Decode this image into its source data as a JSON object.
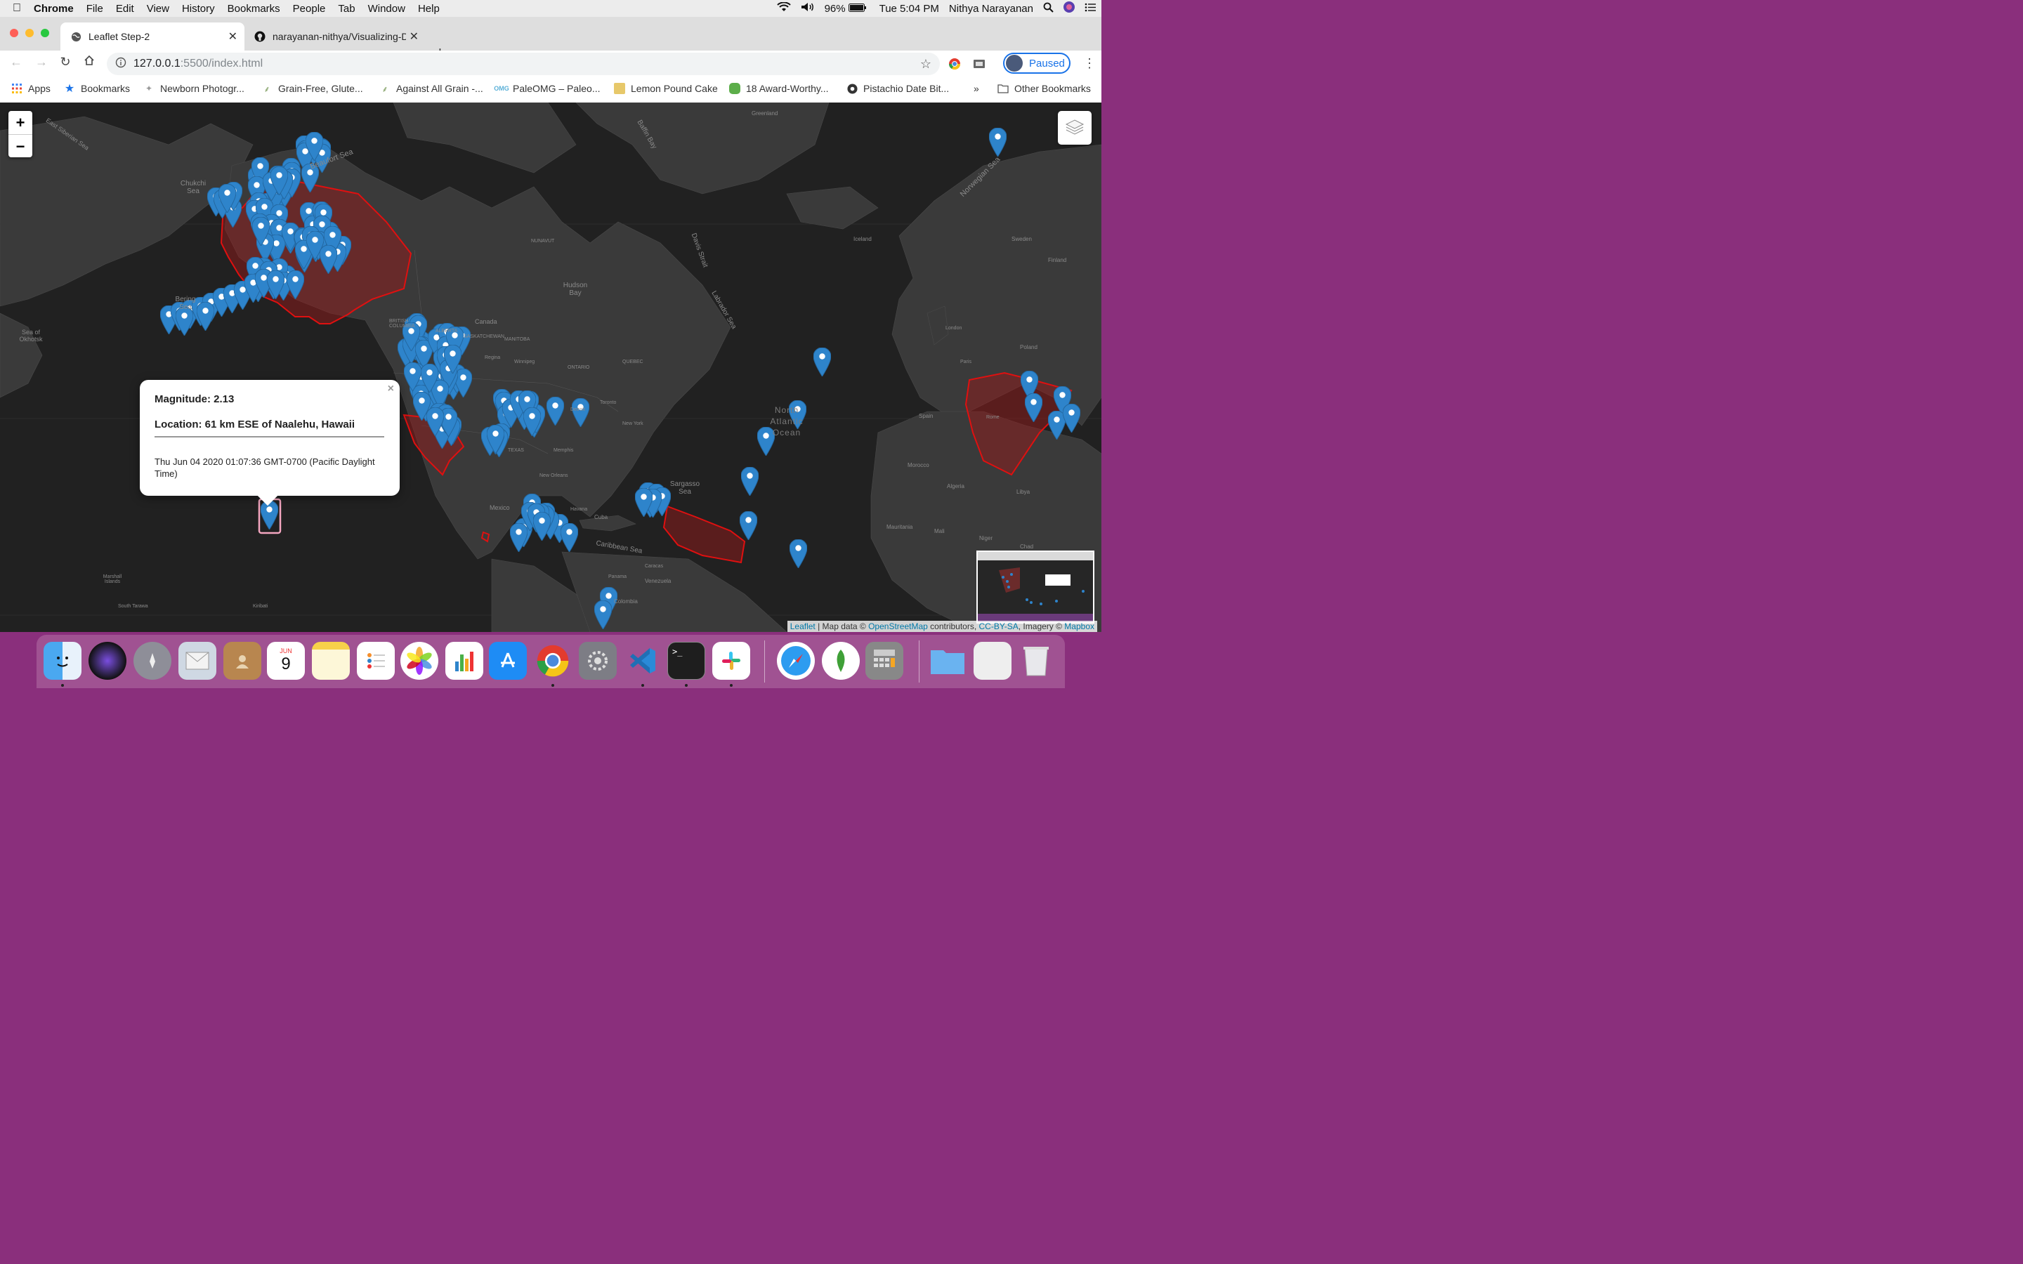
{
  "menubar": {
    "app": "Chrome",
    "items": [
      "File",
      "Edit",
      "View",
      "History",
      "Bookmarks",
      "People",
      "Tab",
      "Window",
      "Help"
    ],
    "battery": "96%",
    "clock": "Tue 5:04 PM",
    "user": "Nithya Narayanan"
  },
  "tabs": [
    {
      "title": "Leaflet Step-2",
      "icon": "globe-icon",
      "active": true
    },
    {
      "title": "narayanan-nithya/Visualizing-D",
      "icon": "github-icon",
      "active": false
    }
  ],
  "toolbar": {
    "url_host": "127.0.0.1",
    "url_path": ":5500/index.html",
    "profile_label": "Paused"
  },
  "bookmarks": [
    {
      "label": "Apps",
      "icon": "apps-grid-icon"
    },
    {
      "label": "Bookmarks",
      "icon": "star-icon"
    },
    {
      "label": "Newborn Photogr...",
      "icon": "site-icon"
    },
    {
      "label": "Grain-Free, Glute...",
      "icon": "site-icon"
    },
    {
      "label": "Against All Grain -...",
      "icon": "site-icon"
    },
    {
      "label": "PaleOMG – Paleo...",
      "icon": "site-icon"
    },
    {
      "label": "Lemon Pound Cake",
      "icon": "site-icon"
    },
    {
      "label": "18 Award-Worthy...",
      "icon": "site-icon"
    },
    {
      "label": "Pistachio Date Bit...",
      "icon": "site-icon"
    },
    {
      "label": "»",
      "icon": "overflow-icon"
    },
    {
      "label": "Other Bookmarks",
      "icon": "folder-icon"
    }
  ],
  "map": {
    "zoom_in": "+",
    "zoom_out": "−",
    "popup": {
      "magnitude": "Magnitude: 2.13",
      "location": "Location: 61 km ESE of Naalehu, Hawaii",
      "time": "Thu Jun 04 2020 01:07:36 GMT-0700 (Pacific Daylight Time)",
      "close": "×"
    },
    "attribution": {
      "leaflet": "Leaflet",
      "sep": " | Map data © ",
      "osm": "OpenStreetMap",
      "contrib": " contributors, ",
      "license": "CC-BY-SA",
      "imagery": ", Imagery © ",
      "mapbox": "Mapbox"
    },
    "labels": {
      "chukchi": "Chukchi Sea",
      "bering": "Bering Sea",
      "okhotsk": "Sea of Okhotsk",
      "hudson": "Hudson Bay",
      "canada": "Canada",
      "labrador": "Labrador Sea",
      "north_atlantic": "North Atlantic Ocean",
      "sargasso": "Sargasso Sea",
      "caribbean": "Caribbean Sea",
      "mexico": "Mexico",
      "greenland": "Greenland",
      "norwegian": "Norwegian Sea",
      "baffin": "Baffin Bay",
      "east_siberian": "East Siberian Sea",
      "beaufort": "Beaufort Sea",
      "iceland": "Iceland",
      "texas": "TEXAS",
      "new_york": "New York",
      "algeria": "Algeria",
      "libya": "Libya",
      "mali": "Mali",
      "niger": "Niger",
      "chad": "Chad",
      "colombia": "Colombia",
      "venezuela": "Venezuela",
      "marshall": "Marshall Islands",
      "kiribati": "Kiribati",
      "south_tarawa": "South Tarawa",
      "davis": "Davis Strait",
      "sweden": "Sweden",
      "finland": "Finland",
      "poland": "Poland",
      "spain": "Spain",
      "morocco": "Morocco",
      "mauritania": "Mauritania",
      "london": "London",
      "paris": "Paris",
      "rome": "Rome",
      "nunavut": "NUNAVUT",
      "quebec": "QUEBEC",
      "ontario": "ONTARIO",
      "manitoba": "MANITOBA",
      "saskatchewan": "SASKATCHEWAN",
      "alberta": "ALBERTA",
      "bc": "BRITISH COLUMBIA",
      "cuba": "Cuba",
      "havana": "Havana",
      "panama": "Panama",
      "caracas": "Caracas",
      "new_orleans": "New Orleans",
      "memphis": "Memphis",
      "detroit": "Detroit",
      "toronto": "Toronto",
      "winnipeg": "Winnipeg",
      "regina": "Regina"
    }
  },
  "dock": {
    "calendar_month": "JUN",
    "calendar_day": "9",
    "terminal_prompt": ">_"
  }
}
